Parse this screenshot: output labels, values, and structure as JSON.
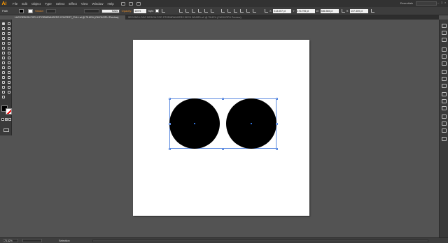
{
  "app": {
    "logo": "Ai"
  },
  "menu": {
    "items": [
      "File",
      "Edit",
      "Object",
      "Type",
      "Select",
      "Effect",
      "View",
      "Window",
      "Help"
    ],
    "workspace": "Essentials"
  },
  "control": {
    "selection_label": "Path",
    "stroke_label": "Stroke:",
    "brush_label": "Basic",
    "opacity_label": "Opacity:",
    "opacity_value": "100%",
    "style_label": "Style:",
    "x_value": "313.057 pt",
    "y_value": "476.795 pt",
    "w_value": "586.565 pt",
    "h_value": "107.309 pt"
  },
  "tabs": [
    {
      "label": "LUO DESIGN FOR 4 STORMRANGERS CONTEST_FULL.ai @ 75.62% (CMYK/GPU Preview)"
    },
    {
      "label": "SECOND LOGO DESIGN FOR STORMRANGERS DECK BOARD.ai* @ 75.62% (CMYK/GPU Preview)"
    }
  ],
  "status": {
    "zoom": "75.62%",
    "tool": "Selection"
  },
  "colors": {
    "fill": "#000000",
    "stroke": "none",
    "selection": "#5b8ae0",
    "accent": "#ff9a00"
  },
  "icons": {
    "tools": [
      "selection-tool-icon",
      "direct-selection-tool-icon",
      "magic-wand-icon",
      "lasso-icon",
      "pen-tool-icon",
      "curvature-icon",
      "type-tool-icon",
      "line-tool-icon",
      "rectangle-tool-icon",
      "paintbrush-icon",
      "pencil-icon",
      "blob-brush-icon",
      "eraser-icon",
      "scissors-icon",
      "rotate-tool-icon",
      "scale-tool-icon",
      "width-tool-icon",
      "warp-tool-icon",
      "free-transform-icon",
      "shape-builder-icon",
      "perspective-grid-icon",
      "mesh-tool-icon",
      "gradient-tool-icon",
      "eyedropper-icon",
      "blend-tool-icon",
      "symbol-sprayer-icon",
      "column-graph-icon",
      "artboard-tool-icon",
      "slice-tool-icon",
      "hand-tool-icon",
      "zoom-tool-icon"
    ],
    "dock": [
      "color-panel-icon",
      "color-guide-icon",
      "swatches-icon",
      "brushes-icon",
      "symbols-icon",
      "stroke-panel-icon",
      "gradient-panel-icon",
      "transparency-icon",
      "appearance-icon",
      "graphic-styles-icon",
      "layers-icon",
      "artboards-icon",
      "align-icon",
      "pathfinder-icon",
      "transform-icon",
      "links-icon"
    ]
  }
}
